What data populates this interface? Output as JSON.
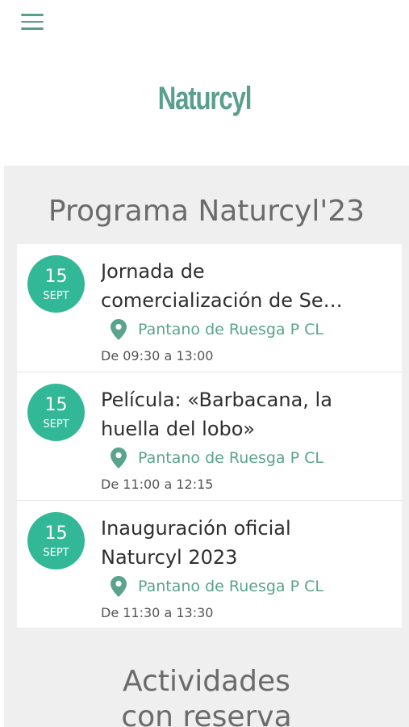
{
  "header": {
    "menu_icon": "hamburger-menu-icon",
    "logo_text": "Naturcyl",
    "accent_color": "#5a9e8e"
  },
  "main": {
    "section_title": "Programa Naturcyl'23",
    "events": [
      {
        "day": "15",
        "month": "SEPT",
        "title_line1": "Jornada de",
        "title_line2": "comercialización de Se…",
        "location": "Pantano de Ruesga P CL",
        "time": "De 09:30 a 13:00"
      },
      {
        "day": "15",
        "month": "SEPT",
        "title_line1": "Película: «Barbacana, la",
        "title_line2": "huella del lobo»",
        "location": "Pantano de Ruesga P CL",
        "time": "De 11:00 a 12:15"
      },
      {
        "day": "15",
        "month": "SEPT",
        "title_line1": "Inauguración oficial",
        "title_line2": "Naturcyl 2023",
        "location": "Pantano de Ruesga P CL",
        "time": "De 11:30 a 13:30"
      }
    ],
    "second_section_line1": "Actividades",
    "second_section_line2": "con reserva",
    "badge_color": "#33b897",
    "location_icon": "map-pin-icon"
  }
}
